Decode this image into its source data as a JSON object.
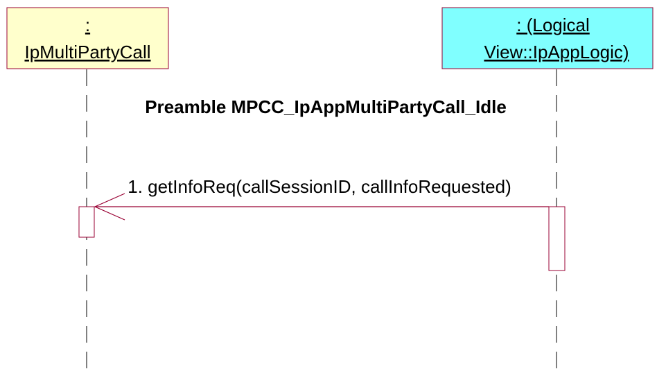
{
  "participants": [
    {
      "id": "caller",
      "line1": ":",
      "line2": "IpMultiPartyCall",
      "fill": "#ffffcc"
    },
    {
      "id": "app-logic",
      "line1": ": (Logical",
      "line2": "View::IpAppLogic)",
      "fill": "#80ffff"
    }
  ],
  "note": {
    "text": "Preamble MPCC_IpAppMultiPartyCall_Idle"
  },
  "messages": [
    {
      "label": "1. getInfoReq(callSessionID, callInfoRequested)",
      "from": "app-logic",
      "to": "caller"
    }
  ],
  "colors": {
    "border": "#990033",
    "lifeline": "#000000"
  }
}
